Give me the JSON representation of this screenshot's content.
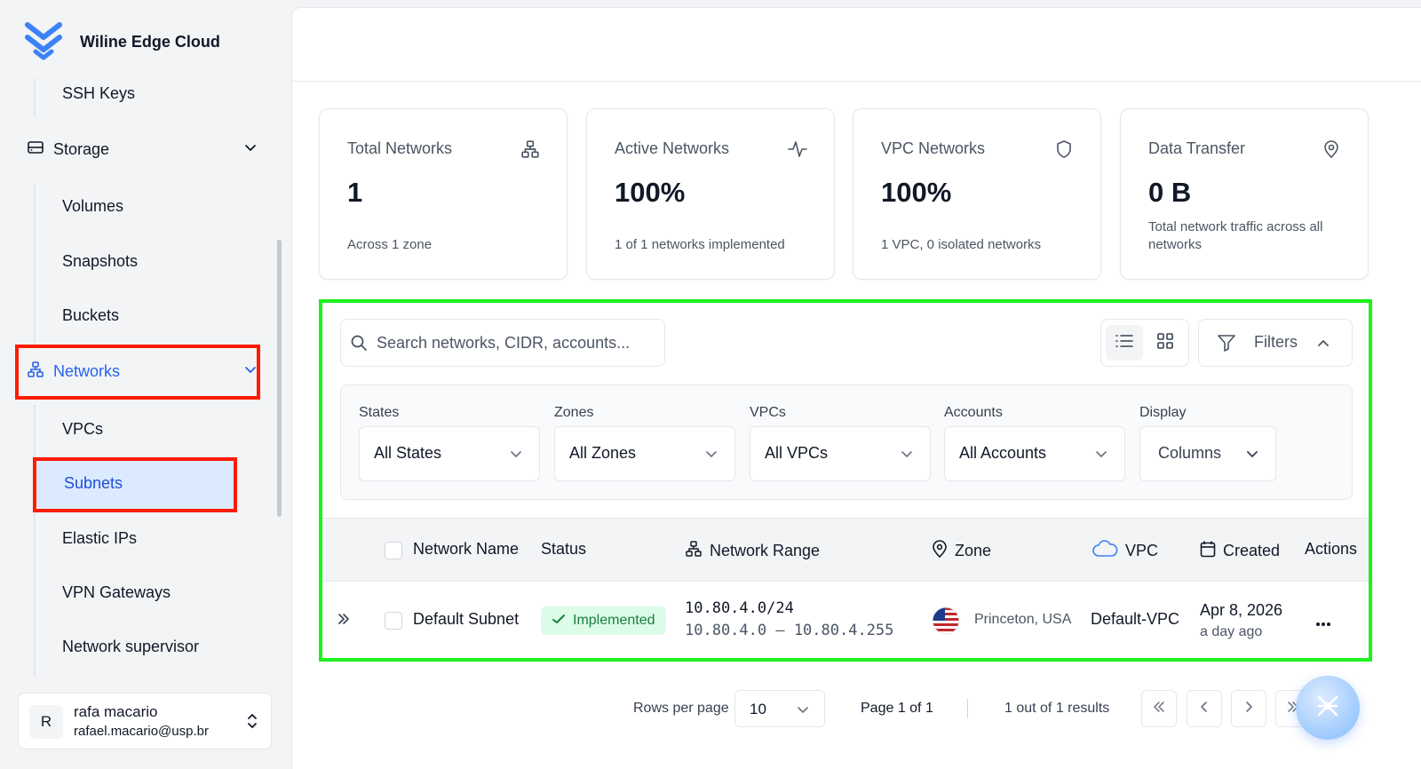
{
  "brand": {
    "name": "Wiline Edge Cloud"
  },
  "sidebar": {
    "items": [
      {
        "label": "SSH Keys"
      },
      {
        "label": "Storage"
      },
      {
        "label": "Volumes"
      },
      {
        "label": "Snapshots"
      },
      {
        "label": "Buckets"
      },
      {
        "label": "Networks"
      },
      {
        "label": "VPCs"
      },
      {
        "label": "Subnets"
      },
      {
        "label": "Elastic IPs"
      },
      {
        "label": "VPN Gateways"
      },
      {
        "label": "Network supervisor"
      }
    ],
    "active_group": "Networks",
    "active_item": "Subnets"
  },
  "user": {
    "initial": "R",
    "name": "rafa macario",
    "email": "rafael.macario@usp.br"
  },
  "stats": [
    {
      "title": "Total Networks",
      "value": "1",
      "sub": "Across 1 zone",
      "icon": "network-icon"
    },
    {
      "title": "Active Networks",
      "value": "100%",
      "sub": "1 of 1 networks implemented",
      "icon": "activity-icon"
    },
    {
      "title": "VPC Networks",
      "value": "100%",
      "sub": "1 VPC, 0 isolated networks",
      "icon": "shield-icon"
    },
    {
      "title": "Data Transfer",
      "value": "0 B",
      "sub": "Total network traffic across all networks",
      "icon": "map-pin-icon"
    }
  ],
  "toolbar": {
    "search_placeholder": "Search networks, CIDR, accounts...",
    "filters_label": "Filters"
  },
  "filters": [
    {
      "label": "States",
      "value": "All States"
    },
    {
      "label": "Zones",
      "value": "All Zones"
    },
    {
      "label": "VPCs",
      "value": "All VPCs"
    },
    {
      "label": "Accounts",
      "value": "All Accounts"
    },
    {
      "label": "Display",
      "value": "Columns"
    }
  ],
  "table": {
    "columns": [
      "Network Name",
      "Status",
      "Network Range",
      "Zone",
      "VPC",
      "Created",
      "Actions"
    ],
    "rows": [
      {
        "name": "Default Subnet",
        "status": "Implemented",
        "cidr": "10.80.4.0/24",
        "range": "10.80.4.0 – 10.80.4.255",
        "zone": "Princeton, USA",
        "vpc": "Default-VPC",
        "created": "Apr 8, 2026",
        "created_relative": "a day ago"
      }
    ]
  },
  "pagination": {
    "rows_label": "Rows per page",
    "rows_value": "10",
    "page_text": "Page 1 of 1",
    "results_text": "1 out of 1 results"
  },
  "colors": {
    "accent": "#2563eb",
    "highlight_red": "#ff1a00",
    "highlight_green": "#1cf21c",
    "status_green": "#15803d"
  }
}
